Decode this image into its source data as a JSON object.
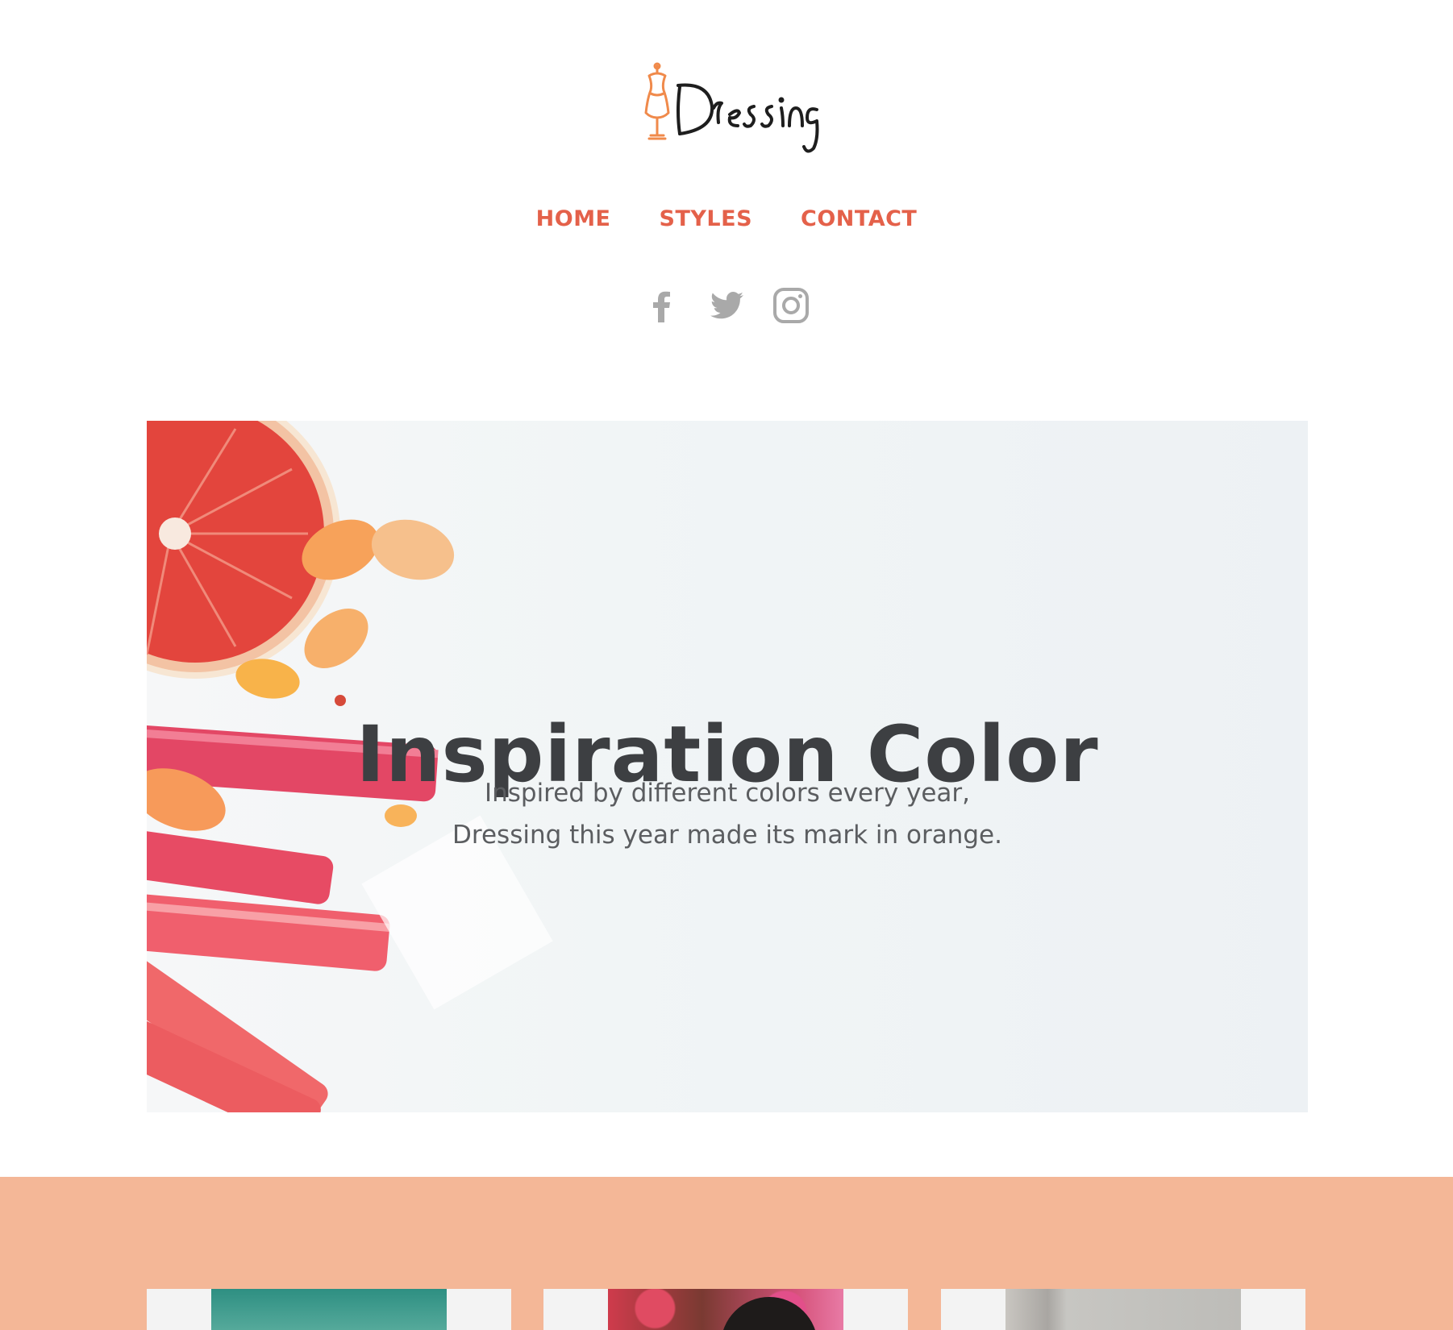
{
  "header": {
    "logo_text": "Dressing",
    "nav": [
      {
        "label": "HOME"
      },
      {
        "label": "STYLES"
      },
      {
        "label": "CONTACT"
      }
    ],
    "social": [
      {
        "icon": "facebook-icon"
      },
      {
        "icon": "twitter-icon"
      },
      {
        "icon": "instagram-icon"
      }
    ]
  },
  "hero": {
    "title": "Inspiration Color",
    "subtitle_line1": "Inspired by different colors every year,",
    "subtitle_line2": "Dressing this year made its mark in orange."
  },
  "colors": {
    "accent": "#e4614a",
    "band": "#f4b797",
    "title": "#3d3f42",
    "icon_gray": "#a9a9a9"
  }
}
